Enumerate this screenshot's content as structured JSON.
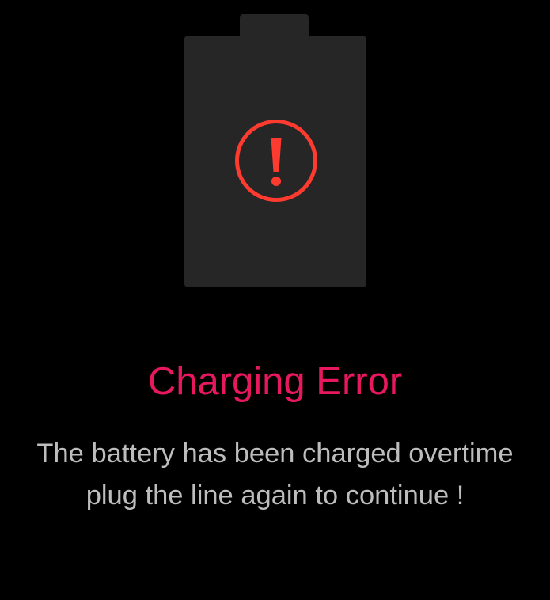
{
  "colors": {
    "background": "#000000",
    "battery": "#262626",
    "warning_icon": "#ff3b30",
    "title": "#e8185f",
    "message": "#bdbdbd"
  },
  "icon": "exclamation-circle-icon",
  "title": "Charging Error",
  "message": {
    "line1": "The battery has been charged overtime",
    "line2": "plug the line again to continue !"
  }
}
